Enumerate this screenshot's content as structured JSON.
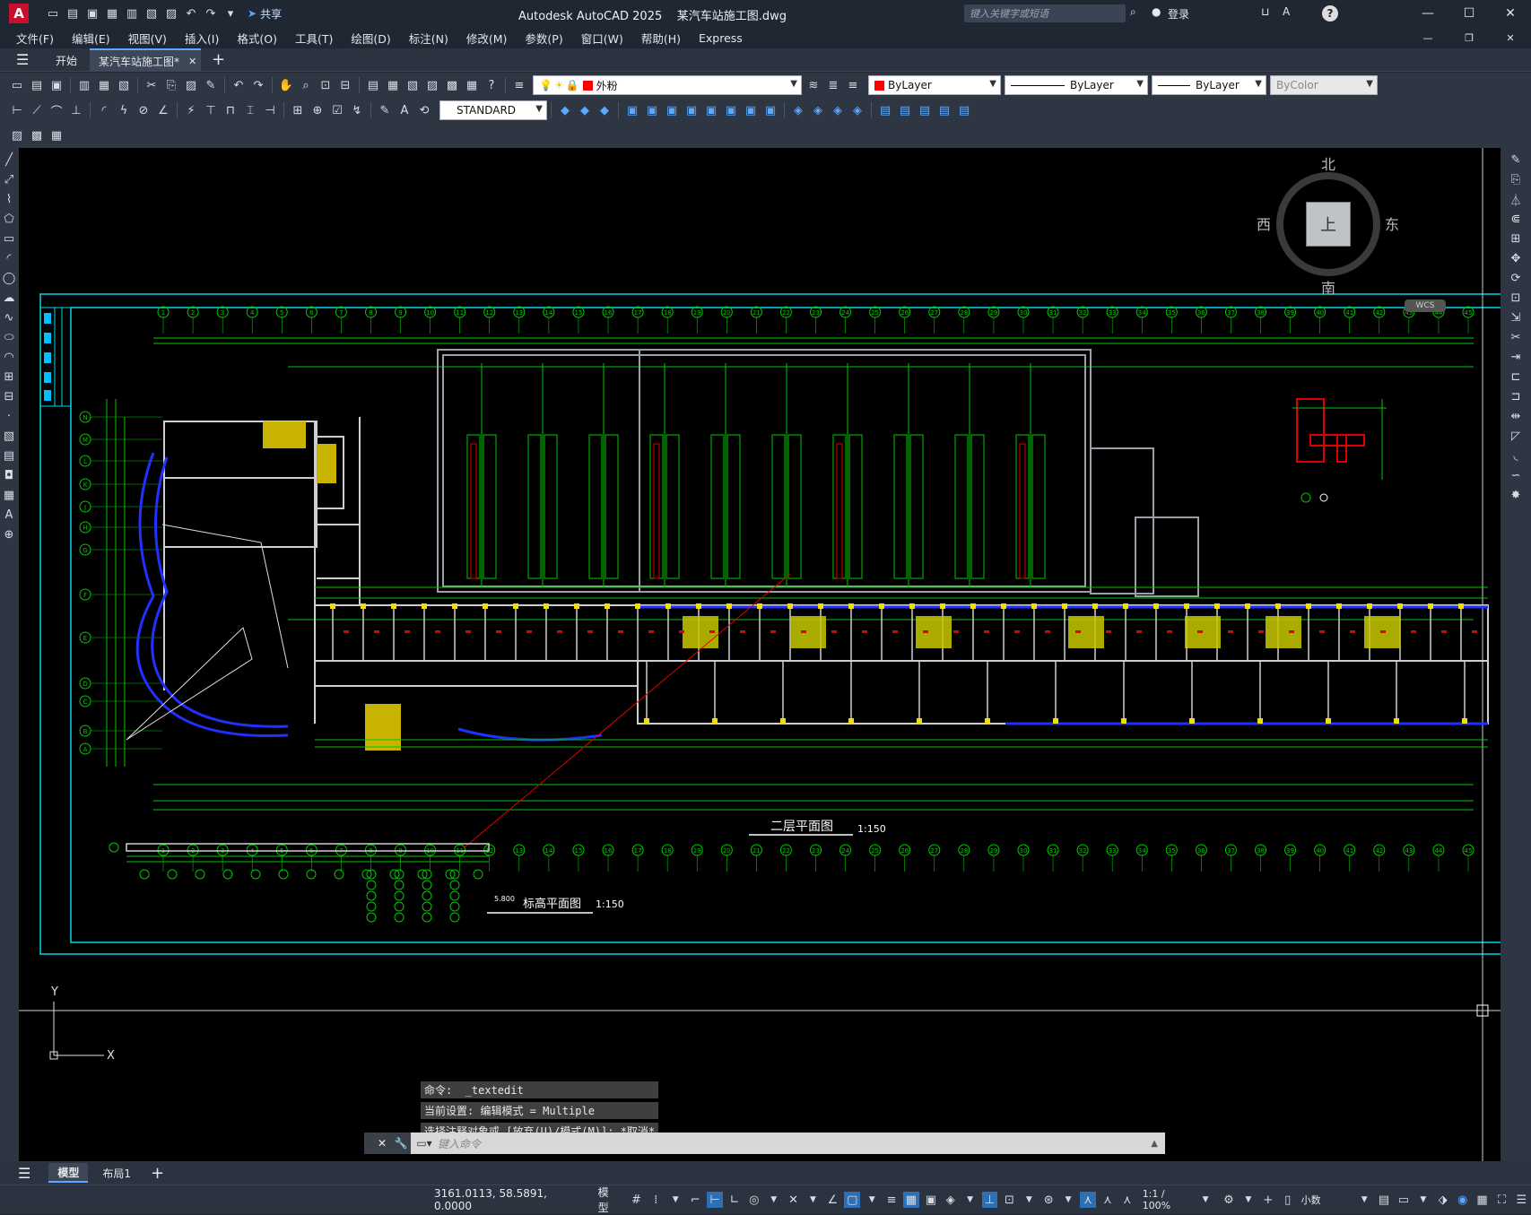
{
  "titlebar": {
    "app_badge": "A",
    "share_label": "共享",
    "title": "Autodesk AutoCAD 2025    某汽车站施工图.dwg",
    "search_placeholder": "键入关键字或短语",
    "login_label": "登录",
    "help_label": "?"
  },
  "menu": [
    "文件(F)",
    "编辑(E)",
    "视图(V)",
    "插入(I)",
    "格式(O)",
    "工具(T)",
    "绘图(D)",
    "标注(N)",
    "修改(M)",
    "参数(P)",
    "窗口(W)",
    "帮助(H)",
    "Express"
  ],
  "tabs": {
    "start": "开始",
    "drawing": "某汽车站施工图*"
  },
  "toolbar": {
    "layer_name": "外粉",
    "layer_color": "#ff0000",
    "color_combo": "ByLayer",
    "linetype_combo": "ByLayer",
    "lineweight_combo": "ByLayer",
    "plotstyle_combo": "ByColor",
    "textstyle_combo": "STANDARD"
  },
  "viewcube": {
    "north": "北",
    "south": "南",
    "east": "东",
    "west": "西",
    "face": "上",
    "wcs": "WCS"
  },
  "drawing": {
    "grid_top": [
      "1",
      "2",
      "3",
      "4",
      "5",
      "6",
      "7",
      "8",
      "9",
      "10",
      "11",
      "12",
      "13",
      "14",
      "15",
      "16",
      "17",
      "18",
      "19",
      "20",
      "21",
      "22",
      "23",
      "24",
      "25",
      "26",
      "27",
      "28",
      "29",
      "30",
      "31",
      "32",
      "33",
      "34",
      "35",
      "36",
      "37",
      "38",
      "39",
      "40",
      "41",
      "42",
      "43",
      "44",
      "45"
    ],
    "grid_left": [
      "N",
      "M",
      "L",
      "K",
      "J",
      "H",
      "G",
      "F",
      "E",
      "D",
      "C",
      "B",
      "A"
    ],
    "title_main": "二层平面图",
    "scale_main": "1:150",
    "title_sub": "标高平面图",
    "scale_sub": "1:150",
    "elevation": "5.800",
    "ucs_x": "X",
    "ucs_y": "Y"
  },
  "command": {
    "lines": [
      "命令:  _textedit",
      "当前设置: 编辑模式 = Multiple",
      "选择注释对象或 [放弃(U)/模式(M)]: *取消*"
    ],
    "placeholder": "键入命令"
  },
  "layouts": {
    "model": "模型",
    "layout1": "布局1"
  },
  "status": {
    "coords": "3161.0113, 58.5891, 0.0000",
    "model": "模型",
    "scale": "1:1 / 100%",
    "units": "小数"
  }
}
